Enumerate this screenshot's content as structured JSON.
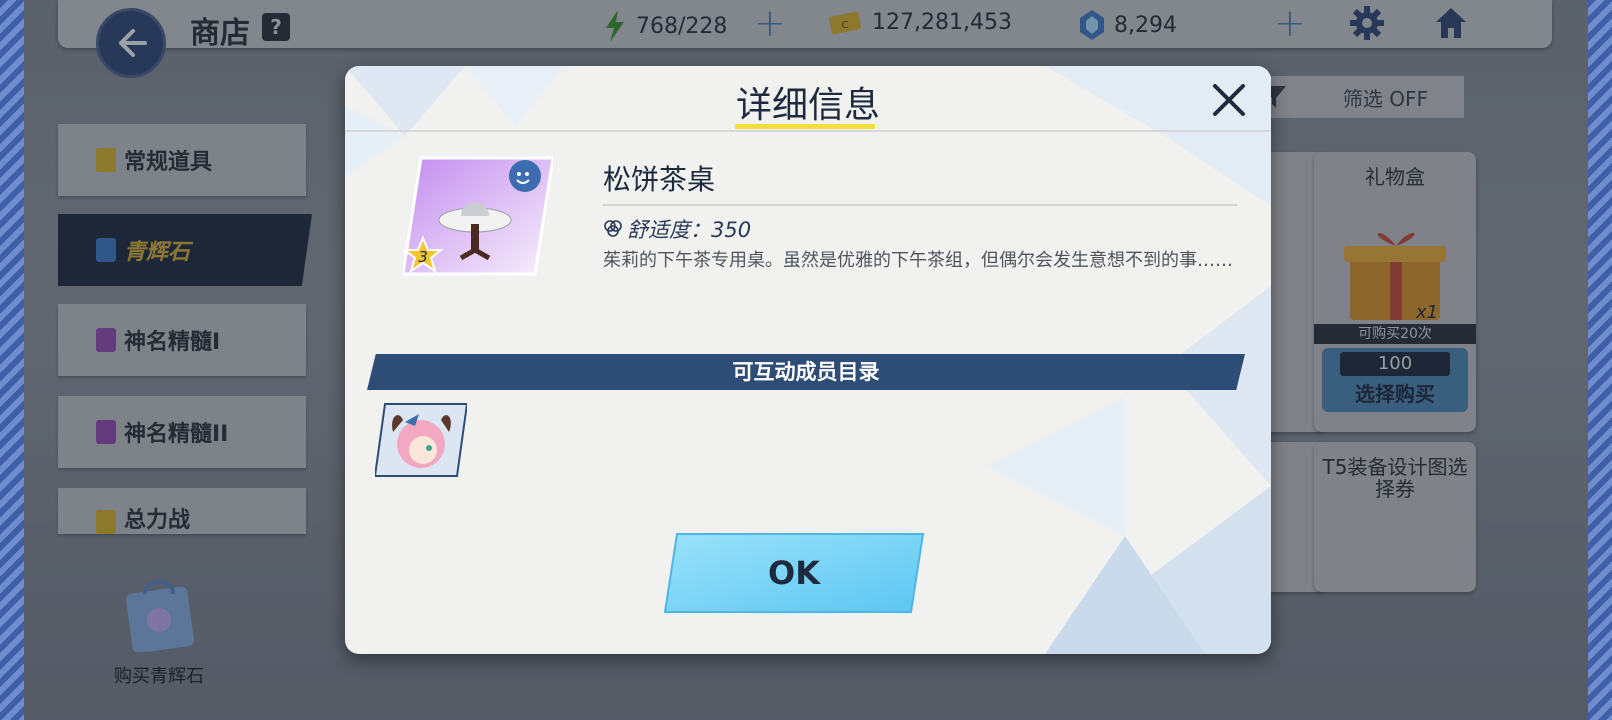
{
  "topbar": {
    "shop_title": "商店",
    "help_label": "?",
    "ap": "768/228",
    "credits": "127,281,453",
    "gems": "8,294"
  },
  "sidebar": {
    "items": [
      {
        "label": "常规道具"
      },
      {
        "label": "青辉石"
      },
      {
        "label": "神名精髓I"
      },
      {
        "label": "神名精髓II"
      },
      {
        "label": "总力战"
      }
    ]
  },
  "filter": {
    "label": "筛选 OFF"
  },
  "shop_cards": {
    "gift_box": {
      "title": "礼物盒",
      "count": "x1",
      "limit": "可购买20次",
      "price": "100",
      "buy_label": "选择购买"
    },
    "t5_ticket": {
      "title": "T5装备设计图选择券"
    }
  },
  "buy_gems_label": "购买青辉石",
  "modal": {
    "title": "详细信息",
    "item_name": "松饼茶桌",
    "item_stars": "3",
    "comfort": "舒适度：350",
    "description": "茱莉的下午茶专用桌。虽然是优雅的下午茶组，但偶尔会发生意想不到的事……",
    "members_heading": "可互动成员目录",
    "ok_label": "OK"
  },
  "colors": {
    "accent_navy": "#2e4d76",
    "title_underline": "#f2de3c",
    "ok_button": "#6dcdf5"
  }
}
